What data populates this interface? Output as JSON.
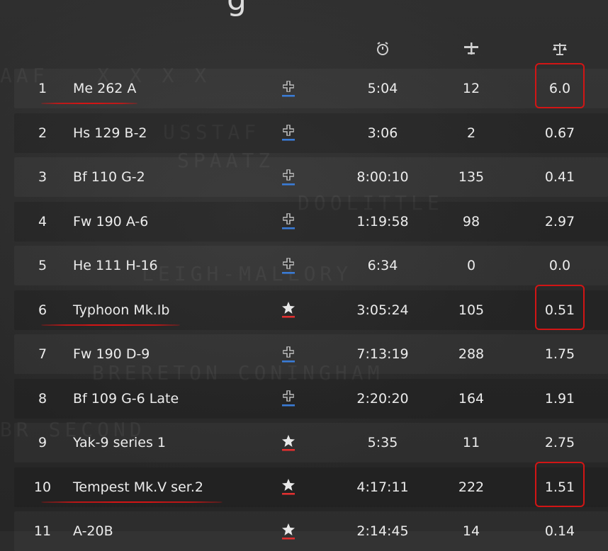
{
  "page": {
    "title_fragment": "g"
  },
  "header": {
    "icons": [
      "alarm-clock-icon",
      "airplane-icon",
      "balance-scale-icon"
    ]
  },
  "rows": [
    {
      "rank": "1",
      "name": "Me 262 A",
      "nation": "german",
      "time": "5:04",
      "kills": "12",
      "kd": "6.0",
      "highlight_kd": true,
      "underline_name": true
    },
    {
      "rank": "2",
      "name": "Hs 129 B-2",
      "nation": "german",
      "time": "3:06",
      "kills": "2",
      "kd": "0.67",
      "highlight_kd": false,
      "underline_name": false
    },
    {
      "rank": "3",
      "name": "Bf 110 G-2",
      "nation": "german",
      "time": "8:00:10",
      "kills": "135",
      "kd": "0.41",
      "highlight_kd": false,
      "underline_name": false
    },
    {
      "rank": "4",
      "name": "Fw 190 A-6",
      "nation": "german",
      "time": "1:19:58",
      "kills": "98",
      "kd": "2.97",
      "highlight_kd": false,
      "underline_name": false
    },
    {
      "rank": "5",
      "name": "He 111 H-16",
      "nation": "german",
      "time": "6:34",
      "kills": "0",
      "kd": "0.0",
      "highlight_kd": false,
      "underline_name": false
    },
    {
      "rank": "6",
      "name": "Typhoon Mk.Ib",
      "nation": "allied",
      "time": "3:05:24",
      "kills": "105",
      "kd": "0.51",
      "highlight_kd": true,
      "underline_name": true
    },
    {
      "rank": "7",
      "name": "Fw 190 D-9",
      "nation": "german",
      "time": "7:13:19",
      "kills": "288",
      "kd": "1.75",
      "highlight_kd": false,
      "underline_name": false
    },
    {
      "rank": "8",
      "name": "Bf 109 G-6 Late",
      "nation": "german",
      "time": "2:20:20",
      "kills": "164",
      "kd": "1.91",
      "highlight_kd": false,
      "underline_name": false
    },
    {
      "rank": "9",
      "name": "Yak-9 series 1",
      "nation": "allied",
      "time": "5:35",
      "kills": "11",
      "kd": "2.75",
      "highlight_kd": false,
      "underline_name": false
    },
    {
      "rank": "10",
      "name": "Tempest Mk.V ser.2",
      "nation": "allied",
      "time": "4:17:11",
      "kills": "222",
      "kd": "1.51",
      "highlight_kd": true,
      "underline_name": true
    },
    {
      "rank": "11",
      "name": "A-20B",
      "nation": "allied",
      "time": "2:14:45",
      "kills": "14",
      "kd": "0.14",
      "highlight_kd": false,
      "underline_name": false
    }
  ],
  "colors": {
    "annotation_red": "#d21515",
    "german_accent": "#3a7bd5",
    "allied_accent": "#e03030"
  }
}
